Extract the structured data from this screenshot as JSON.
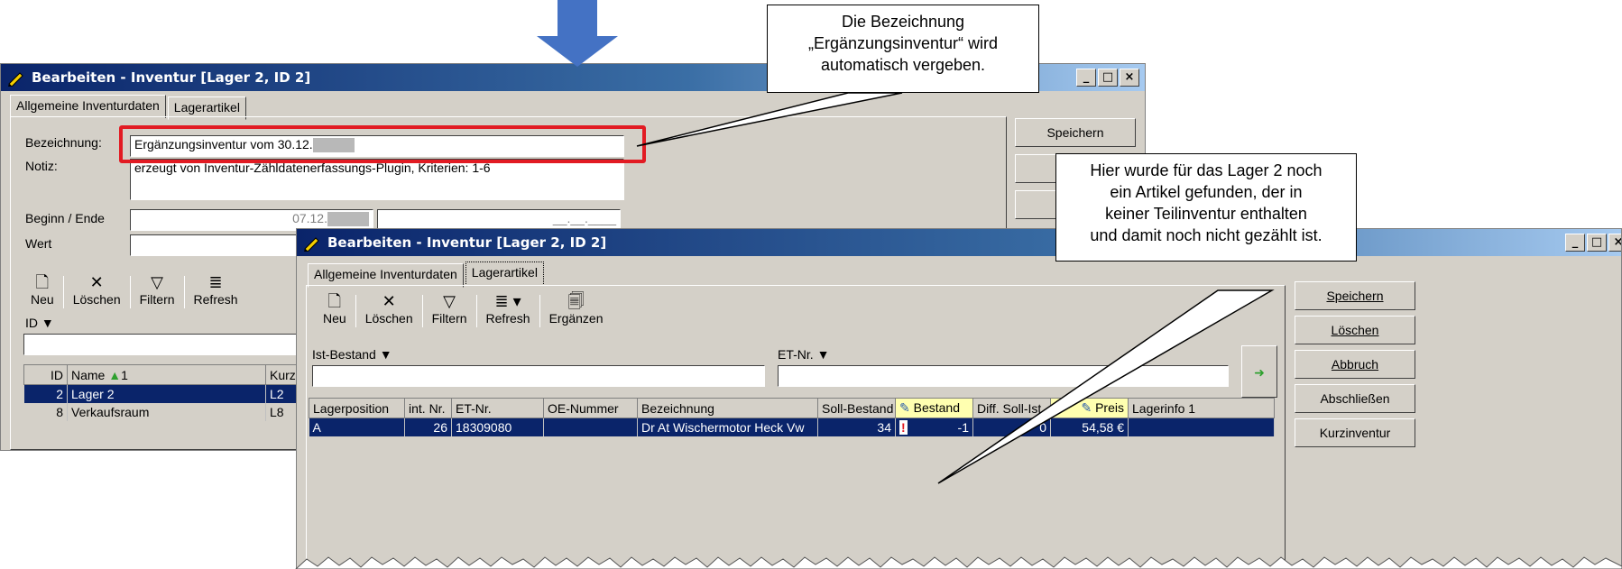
{
  "callout_top": {
    "lines": [
      "Die Bezeichnung",
      "„Ergänzungsinventur“ wird",
      "automatisch vergeben."
    ]
  },
  "callout_right": {
    "lines": [
      "Hier wurde für das Lager 2 noch",
      "ein Artikel gefunden, der in",
      "keiner Teilinventur enthalten",
      "und damit noch nicht gezählt ist."
    ]
  },
  "colors": {
    "accent_red": "#e21b23",
    "arrow_blue": "#4472c4",
    "selection": "#0a246a"
  },
  "win1": {
    "title": "Bearbeiten - Inventur [Lager 2, ID  2]",
    "tabs": [
      "Allgemeine Inventurdaten",
      "Lagerartikel"
    ],
    "labels": {
      "bezeichnung": "Bezeichnung:",
      "notiz": "Notiz:",
      "beginn": "Beginn / Ende",
      "wert": "Wert"
    },
    "bezeichnung_value": "Ergänzungsinventur vom 30.12.",
    "notiz_value": "erzeugt von Inventur-Zähldatenerfassungs-Plugin, Kriterien: 1-6",
    "beginn_value": "07.12.",
    "ende_value": "__.__.____",
    "buttons": {
      "speichern": "Speichern"
    },
    "toolbar": [
      "Neu",
      "Löschen",
      "Filtern",
      "Refresh"
    ],
    "filter_label": "ID",
    "table": {
      "headers": [
        "ID",
        "Name",
        "Kurz"
      ],
      "sort_indicator": "1",
      "rows": [
        [
          "2",
          "Lager 2",
          "L2"
        ],
        [
          "8",
          "Verkaufsraum",
          "L8"
        ]
      ]
    }
  },
  "win2": {
    "title": "Bearbeiten - Inventur [Lager 2, ID  2]",
    "tabs": [
      "Allgemeine Inventurdaten",
      "Lagerartikel"
    ],
    "toolbar": [
      "Neu",
      "Löschen",
      "Filtern",
      "Refresh",
      "Ergänzen"
    ],
    "filters": [
      "Ist-Bestand",
      "ET-Nr."
    ],
    "buttons": [
      "Speichern",
      "Löschen",
      "Abbruch",
      "Abschließen",
      "Kurzinventur"
    ],
    "table": {
      "headers": [
        "Lagerposition",
        "int. Nr.",
        "ET-Nr.",
        "OE-Nummer",
        "Bezeichnung",
        "Soll-Bestand",
        "Bestand",
        "Diff. Soll-Ist",
        "Preis",
        "Lagerinfo 1"
      ],
      "rows": [
        [
          "A",
          "26",
          "18309080",
          "",
          "Dr At Wischermotor Heck Vw",
          "34",
          "-1",
          "0",
          "54,58 €",
          ""
        ]
      ]
    }
  }
}
